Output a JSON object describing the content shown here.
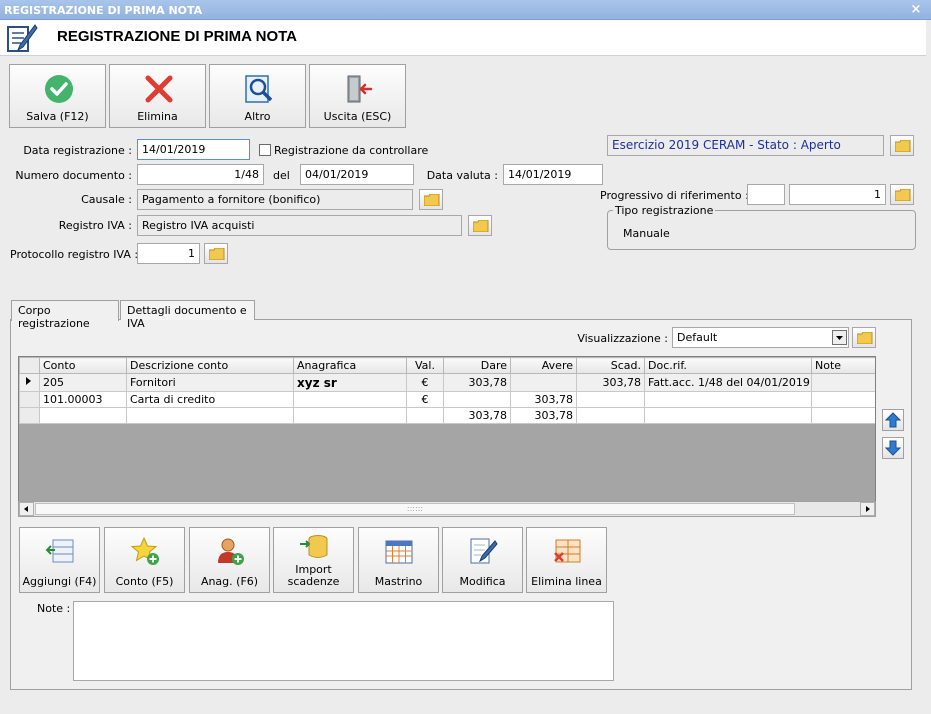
{
  "window": {
    "title": "REGISTRAZIONE DI PRIMA NOTA",
    "close": "×"
  },
  "header": {
    "title": "REGISTRAZIONE DI PRIMA NOTA"
  },
  "toolbar": {
    "save": "Salva (F12)",
    "delete": "Elimina",
    "other": "Altro",
    "exit": "Uscita (ESC)"
  },
  "form": {
    "data_registrazione_label": "Data registrazione :",
    "data_registrazione": "14/01/2019",
    "da_controllare_label": "Registrazione da controllare",
    "numero_documento_label": "Numero documento :",
    "numero_documento": "1/48",
    "del_label": "del",
    "data_documento": "04/01/2019",
    "data_valuta_label": "Data valuta :",
    "data_valuta": "14/01/2019",
    "causale_label": "Causale :",
    "causale": "Pagamento a fornitore (bonifico)",
    "registro_iva_label": "Registro IVA :",
    "registro_iva": "Registro IVA acquisti",
    "protocollo_label": "Protocollo registro IVA :",
    "protocollo": "1",
    "esercizio": "Esercizio 2019 CERAM - Stato : Aperto",
    "progressivo_label": "Progressivo di riferimento :",
    "progressivo_a": "",
    "progressivo_b": "1",
    "tipo_registrazione_label": "Tipo registrazione",
    "tipo_registrazione": "Manuale"
  },
  "tabs": [
    "Corpo registrazione",
    "Dettagli documento e IVA"
  ],
  "visualizzazione": {
    "label": "Visualizzazione :",
    "value": "Default"
  },
  "grid": {
    "columns": [
      "Conto",
      "Descrizione conto",
      "Anagrafica",
      "Val.",
      "Dare",
      "Avere",
      "Scad.",
      "Doc.rif.",
      "Note"
    ],
    "rows": [
      {
        "conto": "205",
        "descrizione": "Fornitori",
        "anagrafica": "xyz sr",
        "val": "€",
        "dare": "303,78",
        "avere": "",
        "scad": "303,78",
        "docrif": "Fatt.acc. 1/48 del 04/01/2019",
        "note": ""
      },
      {
        "conto": "101.00003",
        "descrizione": "Carta di credito",
        "anagrafica": "",
        "val": "€",
        "dare": "",
        "avere": "303,78",
        "scad": "",
        "docrif": "",
        "note": ""
      }
    ],
    "totals": {
      "dare": "303,78",
      "avere": "303,78"
    },
    "scroll_grip": "::::::"
  },
  "actions": {
    "aggiungi": "Aggiungi (F4)",
    "conto": "Conto (F5)",
    "anag": "Anag. (F6)",
    "import_1": "Import",
    "import_2": "scadenze",
    "mastrino": "Mastrino",
    "modifica": "Modifica",
    "elimina_linea": "Elimina linea"
  },
  "note": {
    "label": "Note :",
    "value": ""
  },
  "colors": {
    "title_bar": "#9bb9e4",
    "accent_blue": "#1d2f9c",
    "ok_green": "#44b36b",
    "delete_red": "#e03c31",
    "folder_yellow": "#f2c94c"
  }
}
